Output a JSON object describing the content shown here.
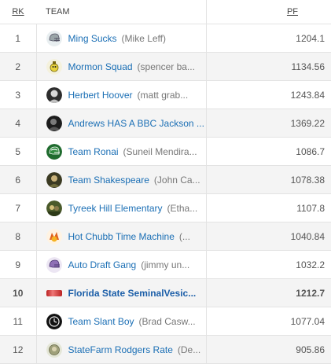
{
  "header": {
    "rank": "RK",
    "team": "TEAM",
    "pf": "PF"
  },
  "rows": [
    {
      "rank": "1",
      "team": "Ming Sucks",
      "owner": "(Mike Leff)",
      "pf": "1204.1",
      "logo": "helmet-icon"
    },
    {
      "rank": "2",
      "team": "Mormon Squad",
      "owner": "(spencer ba...",
      "pf": "1134.56",
      "logo": "character-icon"
    },
    {
      "rank": "3",
      "team": "Herbert Hoover",
      "owner": "(matt grab...",
      "pf": "1243.84",
      "logo": "portrait-icon"
    },
    {
      "rank": "4",
      "team": "Andrews HAS A BBC Jackson ...",
      "owner": "",
      "pf": "1369.22",
      "logo": "portrait-icon"
    },
    {
      "rank": "5",
      "team": "Team Ronai",
      "owner": "(Suneil Mendira...",
      "pf": "1086.7",
      "logo": "helmet-icon"
    },
    {
      "rank": "6",
      "team": "Team Shakespeare",
      "owner": "(John Ca...",
      "pf": "1078.38",
      "logo": "photo-icon"
    },
    {
      "rank": "7",
      "team": "Tyreek Hill Elementary",
      "owner": "(Etha...",
      "pf": "1107.8",
      "logo": "photo-icon"
    },
    {
      "rank": "8",
      "team": "Hot Chubb Time Machine",
      "owner": "(...",
      "pf": "1040.84",
      "logo": "cartoon-icon"
    },
    {
      "rank": "9",
      "team": "Auto Draft Gang",
      "owner": "(jimmy un...",
      "pf": "1032.2",
      "logo": "helmet-icon"
    },
    {
      "rank": "10",
      "team": "Florida State SeminalVesic...",
      "owner": "",
      "pf": "1212.7",
      "logo": "banner-icon",
      "mine": true
    },
    {
      "rank": "11",
      "team": "Team Slant Boy",
      "owner": "(Brad Casw...",
      "pf": "1077.04",
      "logo": "clock-icon"
    },
    {
      "rank": "12",
      "team": "StateFarm Rodgers Rate",
      "owner": "(De...",
      "pf": "905.86",
      "logo": "badge-icon"
    }
  ]
}
